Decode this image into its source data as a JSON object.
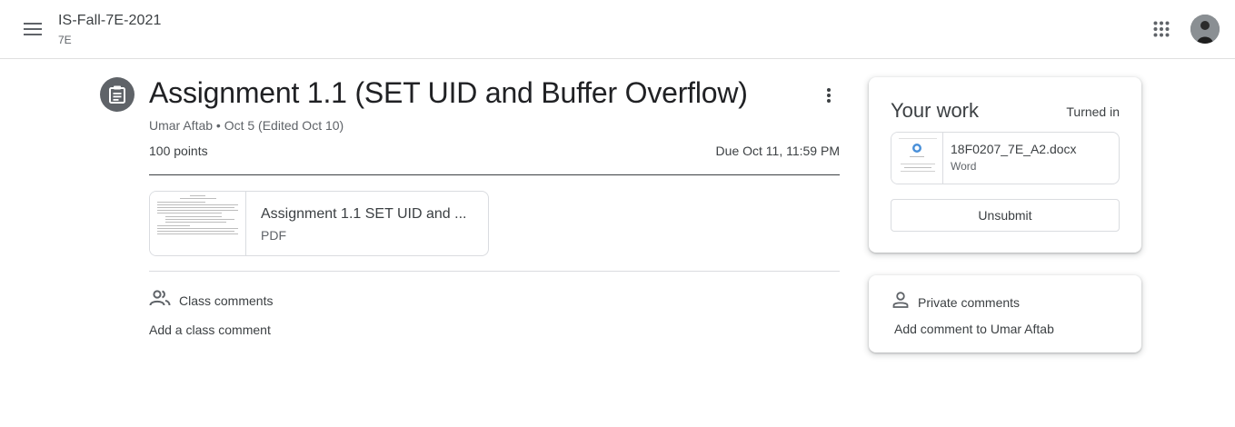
{
  "header": {
    "course_title": "IS-Fall-7E-2021",
    "course_section": "7E",
    "menu_icon": "hamburger-menu-icon",
    "apps_icon": "google-apps-icon",
    "avatar": "user-avatar"
  },
  "assignment": {
    "icon": "assignment-icon",
    "title": "Assignment 1.1 (SET UID and Buffer Overflow)",
    "meta": "Umar Aftab • Oct 5 (Edited Oct 10)",
    "points": "100 points",
    "due": "Due Oct 11, 11:59 PM",
    "attachment": {
      "name": "Assignment 1.1 SET UID and ...",
      "type": "PDF"
    }
  },
  "class_comments": {
    "label": "Class comments",
    "add_label": "Add a class comment"
  },
  "your_work": {
    "title": "Your work",
    "status": "Turned in",
    "file": {
      "name": "18F0207_7E_A2.docx",
      "type": "Word"
    },
    "unsubmit_label": "Unsubmit"
  },
  "private_comments": {
    "label": "Private comments",
    "add_label": "Add comment to Umar Aftab"
  },
  "colors": {
    "icon_gray": "#5f6368",
    "text": "#3c4043",
    "border": "#dadce0"
  }
}
